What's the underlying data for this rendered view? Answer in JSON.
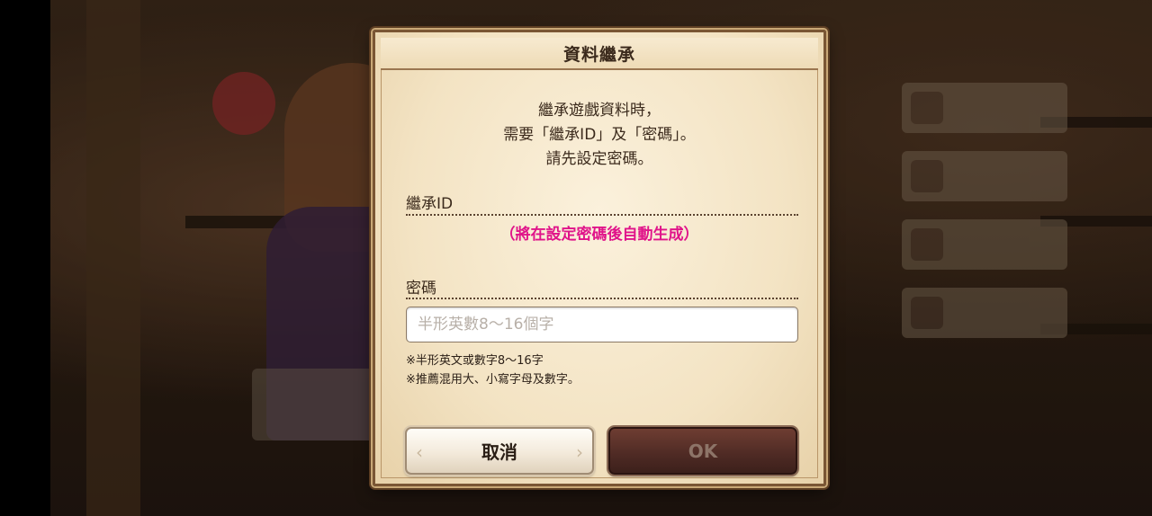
{
  "dialog": {
    "title": "資料繼承",
    "intro_lines": [
      "繼承遊戲資料時，",
      "需要「繼承ID」及「密碼」。",
      "請先設定密碼。"
    ],
    "inherit_id_label": "繼承ID",
    "inherit_id_note": "（將在設定密碼後自動生成）",
    "password_label": "密碼",
    "password_value": "",
    "password_placeholder": "半形英數8～16個字",
    "hints": [
      "※半形英文或數字8～16字",
      "※推薦混用大、小寫字母及數字。"
    ],
    "cancel_label": "取消",
    "ok_label": "OK"
  },
  "colors": {
    "accent_note": "#e0148a",
    "dialog_bg": "#f3e3c3",
    "ok_button": "#4e2a24",
    "border": "#7a5634"
  }
}
